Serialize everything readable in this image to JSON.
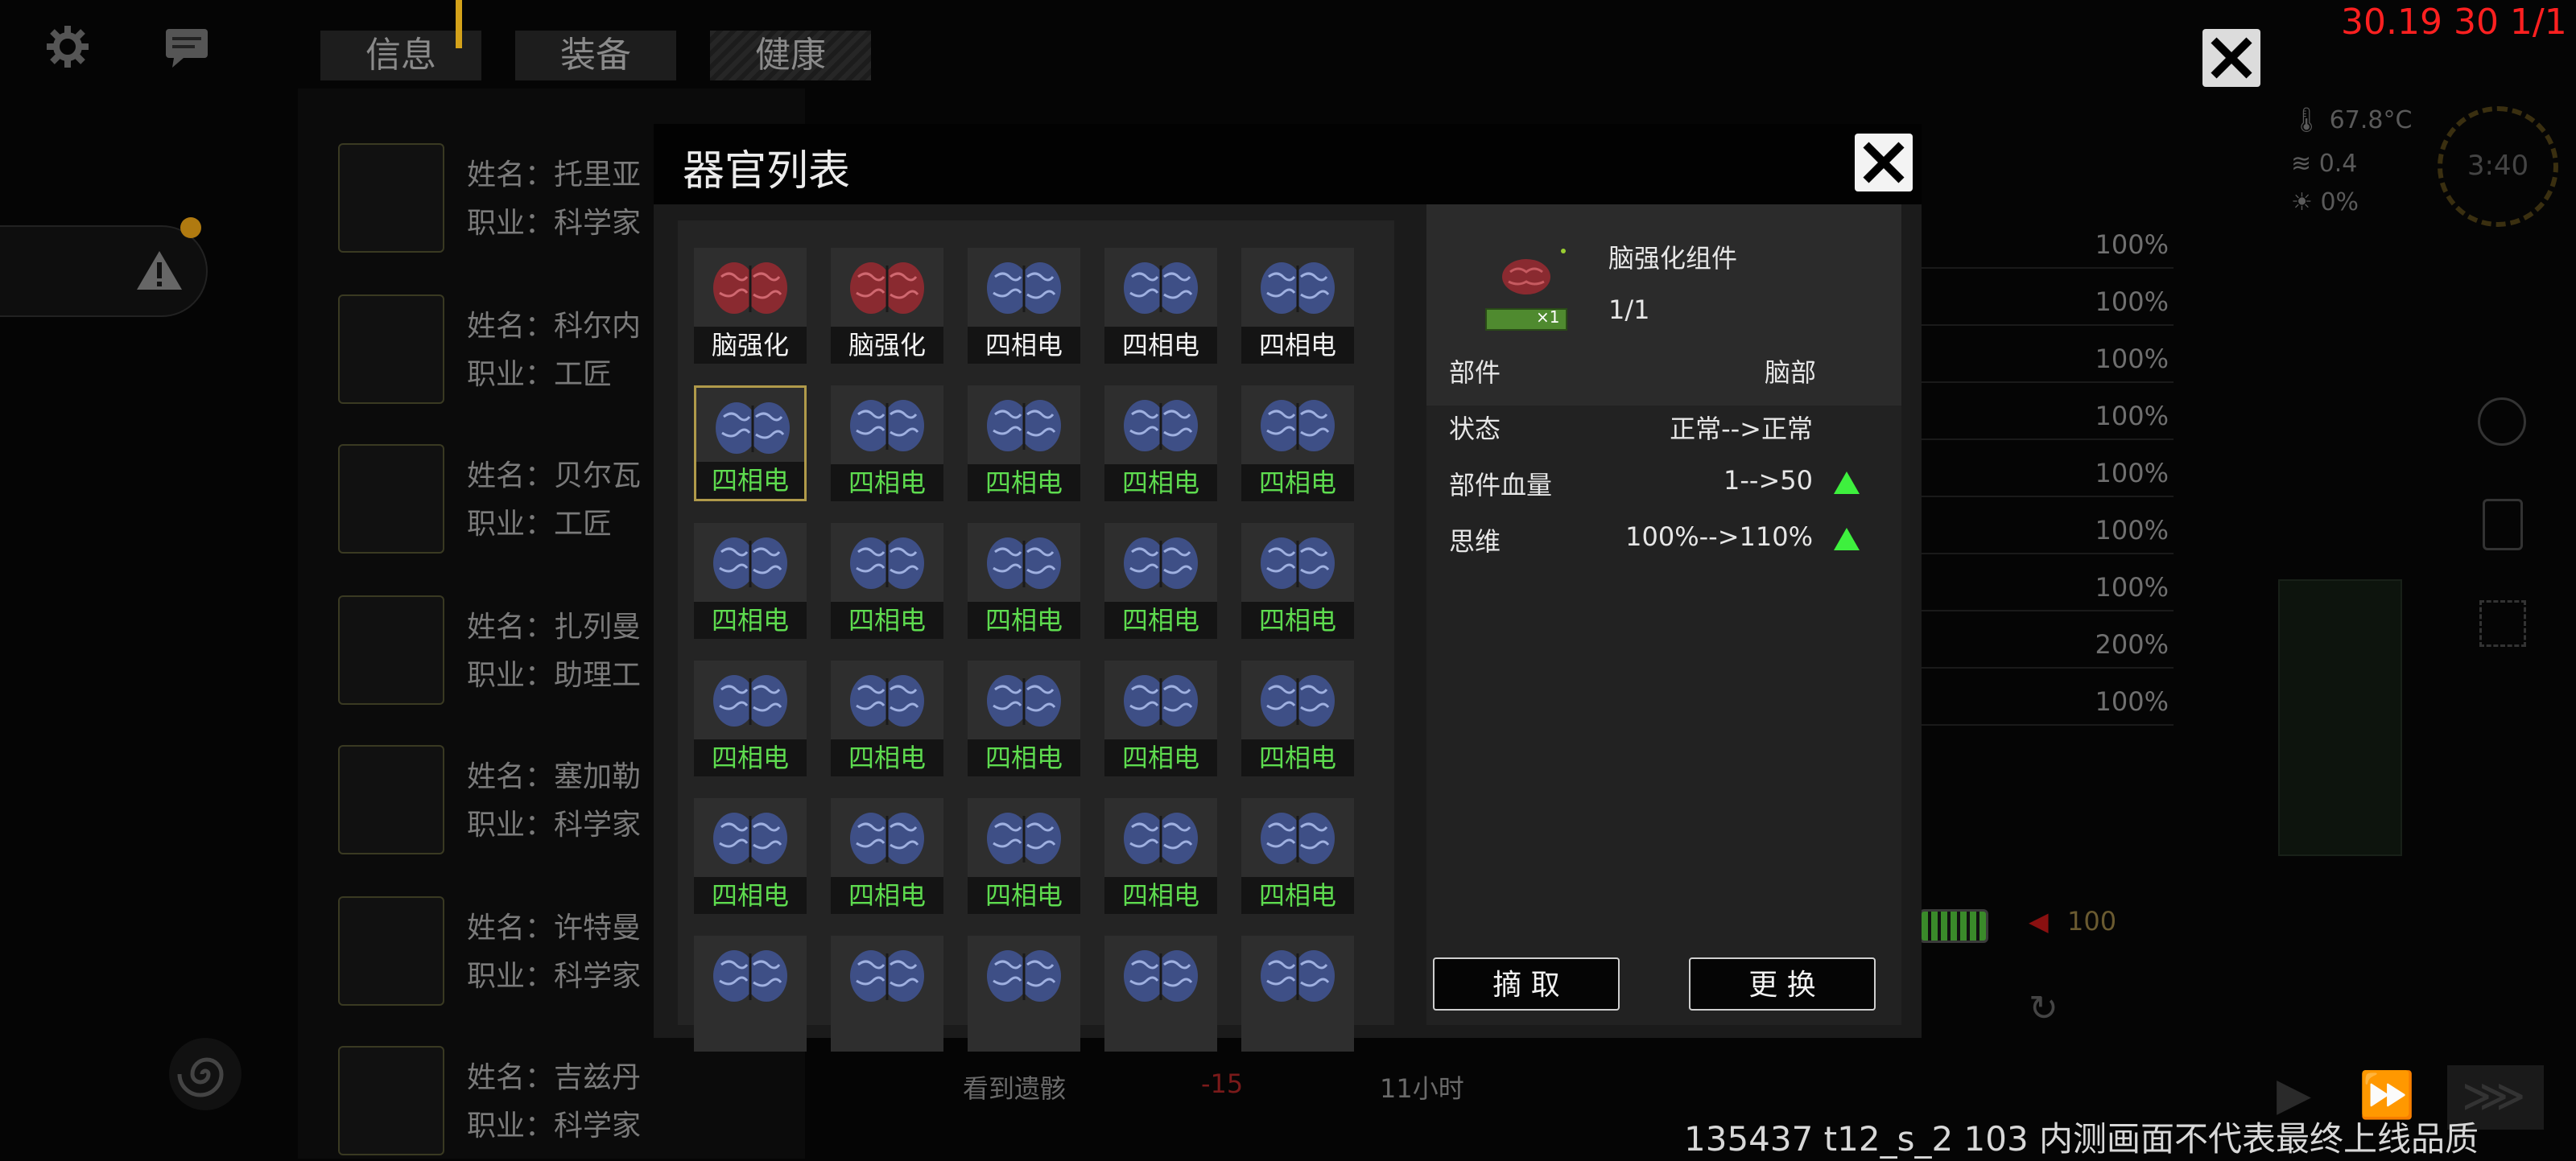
{
  "top_right_status": "30.19 30 1/1",
  "build_watermark": "135437 t12_s_2 103  内测画面不代表最终上线品质",
  "tabs": [
    "信息",
    "装备",
    "健康"
  ],
  "characters": [
    {
      "name": "姓名：托里亚",
      "job": "职业：科学家"
    },
    {
      "name": "姓名：科尔内",
      "job": "职业：工匠"
    },
    {
      "name": "姓名：贝尔瓦",
      "job": "职业：工匠"
    },
    {
      "name": "姓名：扎列曼",
      "job": "职业：助理工"
    },
    {
      "name": "姓名：塞加勒",
      "job": "职业：科学家"
    },
    {
      "name": "姓名：许特曼",
      "job": "职业：科学家"
    },
    {
      "name": "姓名：吉兹丹",
      "job": "职业：科学家"
    }
  ],
  "env_stats": {
    "temperature": "67.8°C",
    "wind": "0.4",
    "light": "0%",
    "clock": "3:40"
  },
  "percent_column": [
    "100%",
    "100%",
    "100%",
    "100%",
    "100%",
    "100%",
    "100%",
    "200%",
    "100%"
  ],
  "bottom_info": {
    "event": "看到遗骸",
    "value": "-15",
    "time": "11小时",
    "meter_value": "100"
  },
  "modal": {
    "title": "器官列表",
    "organs": [
      {
        "label": "脑强化",
        "kind": "red"
      },
      {
        "label": "脑强化",
        "kind": "red"
      },
      {
        "label": "四相电",
        "kind": "blue"
      },
      {
        "label": "四相电",
        "kind": "blue"
      },
      {
        "label": "四相电",
        "kind": "blue"
      },
      {
        "label": "四相电",
        "kind": "blue-green"
      },
      {
        "label": "四相电",
        "kind": "blue-green"
      },
      {
        "label": "四相电",
        "kind": "blue-green"
      },
      {
        "label": "四相电",
        "kind": "blue-green"
      },
      {
        "label": "四相电",
        "kind": "blue-green"
      },
      {
        "label": "四相电",
        "kind": "blue-green"
      },
      {
        "label": "四相电",
        "kind": "blue-green"
      },
      {
        "label": "四相电",
        "kind": "blue-green"
      },
      {
        "label": "四相电",
        "kind": "blue-green"
      },
      {
        "label": "四相电",
        "kind": "blue-green"
      },
      {
        "label": "四相电",
        "kind": "blue-green"
      },
      {
        "label": "四相电",
        "kind": "blue-green"
      },
      {
        "label": "四相电",
        "kind": "blue-green"
      },
      {
        "label": "四相电",
        "kind": "blue-green"
      },
      {
        "label": "四相电",
        "kind": "blue-green"
      },
      {
        "label": "四相电",
        "kind": "blue-green"
      },
      {
        "label": "四相电",
        "kind": "blue-green"
      },
      {
        "label": "四相电",
        "kind": "blue-green"
      },
      {
        "label": "四相电",
        "kind": "blue-green"
      },
      {
        "label": "四相电",
        "kind": "blue-green"
      },
      {
        "label": "",
        "kind": "blue"
      },
      {
        "label": "",
        "kind": "blue"
      },
      {
        "label": "",
        "kind": "blue"
      },
      {
        "label": "",
        "kind": "blue"
      },
      {
        "label": "",
        "kind": "blue"
      }
    ],
    "selected_index": 5,
    "detail": {
      "item_name": "脑强化组件",
      "item_count": "1/1",
      "item_badge": "×1",
      "part_label": "部件",
      "part_value": "脑部",
      "rows": [
        {
          "label": "状态",
          "value": "正常-->正常",
          "arrow": false
        },
        {
          "label": "部件血量",
          "value": "1-->50",
          "arrow": true
        },
        {
          "label": "思维",
          "value": "100%-->110%",
          "arrow": true
        }
      ]
    },
    "buttons": {
      "remove": "摘 取",
      "replace": "更 换"
    }
  },
  "colors": {
    "accent_red": "#ff2020",
    "green_label": "#5edc4f",
    "up_arrow": "#3ef03e",
    "selected_border": "#b09a4a"
  }
}
